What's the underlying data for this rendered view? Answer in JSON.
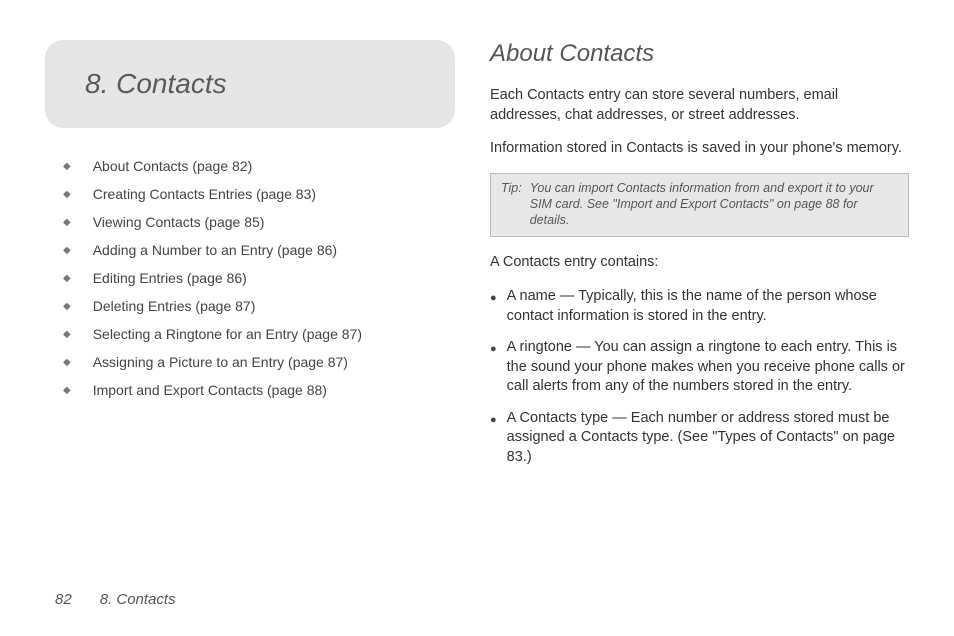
{
  "chapter": {
    "number": "8.",
    "title": "Contacts",
    "full_title": "8.   Contacts"
  },
  "toc": [
    "About Contacts (page 82)",
    "Creating Contacts Entries (page 83)",
    "Viewing Contacts (page 85)",
    "Adding a Number to an Entry (page 86)",
    "Editing Entries (page 86)",
    "Deleting Entries (page 87)",
    "Selecting a Ringtone for an Entry (page 87)",
    "Assigning a Picture to an Entry (page 87)",
    "Import and Export Contacts (page 88)"
  ],
  "section": {
    "title": "About Contacts",
    "para1": "Each Contacts entry can store several numbers, email addresses, chat addresses, or street addresses.",
    "para2": "Information stored in Contacts is saved in your phone's memory.",
    "tip_label": "Tip:",
    "tip_text": "You can import Contacts information from and export it to your SIM card. See \"Import and Export Contacts\" on page 88 for details.",
    "contains_intro": "A Contacts entry contains:",
    "bullets": [
      "A name — Typically, this is the name of the person whose contact information is stored in the entry.",
      "A ringtone — You can assign a ringtone to each entry. This is the sound your phone makes when you receive phone calls or call alerts from any of the numbers stored in the entry.",
      "A Contacts type — Each number or address stored must be assigned a Contacts type. (See \"Types of Contacts\" on page 83.)"
    ]
  },
  "footer": {
    "page_number": "82",
    "chapter_ref": "8. Contacts"
  }
}
